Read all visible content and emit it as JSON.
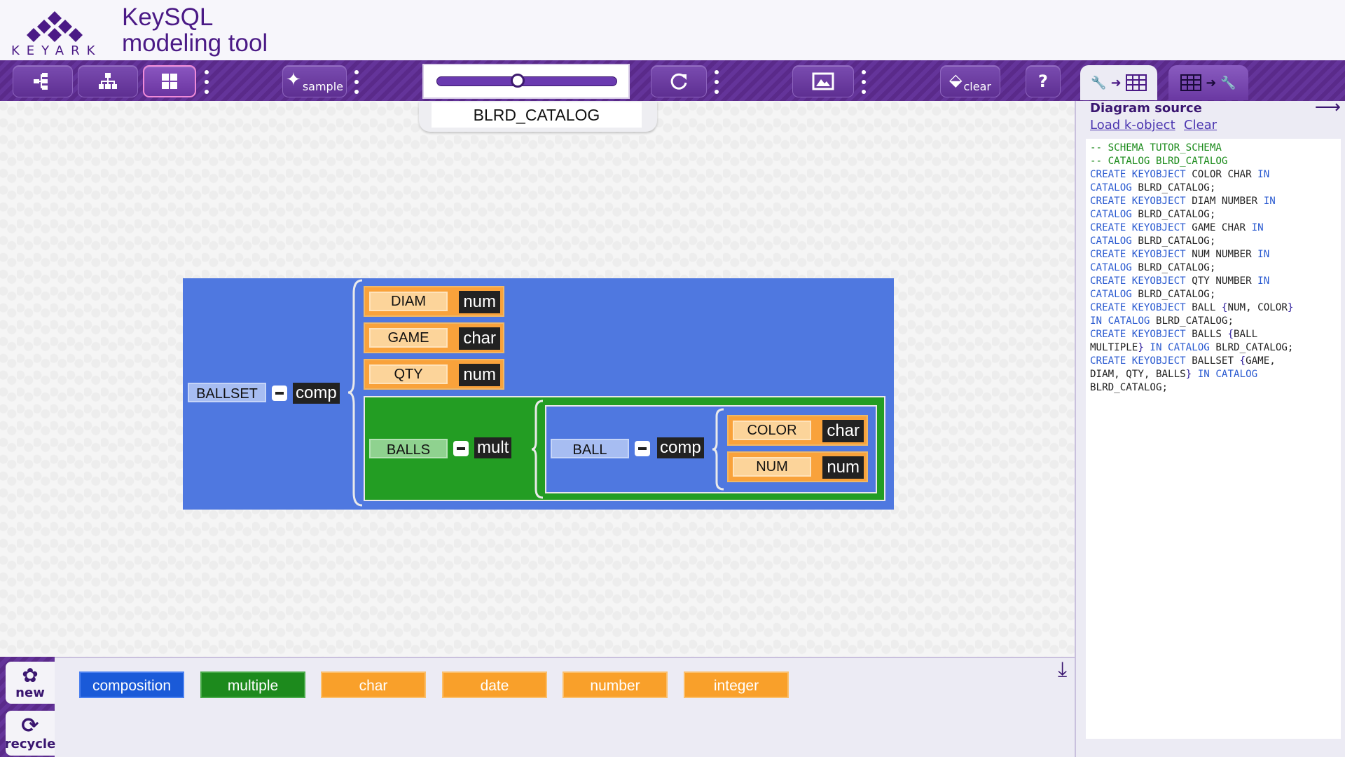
{
  "app": {
    "logo_text": "KEYARK",
    "title_line1": "KeySQL",
    "title_line2": "modeling tool"
  },
  "toolbar": {
    "sample_label": "sample",
    "clear_label": "clear",
    "help_label": "?",
    "zoom_level": 0.45
  },
  "canvas": {
    "catalog_name": "BLRD_CATALOG"
  },
  "diagram": {
    "ballset": {
      "name": "BALLSET",
      "kind": "comp"
    },
    "leaves": [
      {
        "name": "DIAM",
        "type": "num"
      },
      {
        "name": "GAME",
        "type": "char"
      },
      {
        "name": "QTY",
        "type": "num"
      }
    ],
    "balls": {
      "name": "BALLS",
      "kind": "mult"
    },
    "ball": {
      "name": "BALL",
      "kind": "comp"
    },
    "ball_leaves": [
      {
        "name": "COLOR",
        "type": "char"
      },
      {
        "name": "NUM",
        "type": "num"
      }
    ]
  },
  "palette": {
    "new_label": "new",
    "recycle_label": "recycle",
    "items": [
      "composition",
      "multiple",
      "char",
      "date",
      "number",
      "integer"
    ]
  },
  "right_panel": {
    "title": "Diagram source",
    "load_link": "Load k-object",
    "clear_link": "Clear",
    "code": [
      {
        "t": "c",
        "s": "-- SCHEMA TUTOR_SCHEMA"
      },
      {
        "t": "c",
        "s": "-- CATALOG BLRD_CATALOG"
      },
      {
        "t": "line",
        "parts": [
          [
            "k",
            "CREATE KEYOBJECT"
          ],
          [
            "n",
            " COLOR CHAR "
          ],
          [
            "k",
            "IN"
          ]
        ]
      },
      {
        "t": "line",
        "parts": [
          [
            "k",
            "CATALOG"
          ],
          [
            "n",
            " BLRD_CATALOG;"
          ]
        ]
      },
      {
        "t": "line",
        "parts": [
          [
            "k",
            "CREATE KEYOBJECT"
          ],
          [
            "n",
            " DIAM NUMBER "
          ],
          [
            "k",
            "IN"
          ]
        ]
      },
      {
        "t": "line",
        "parts": [
          [
            "k",
            "CATALOG"
          ],
          [
            "n",
            " BLRD_CATALOG;"
          ]
        ]
      },
      {
        "t": "line",
        "parts": [
          [
            "k",
            "CREATE KEYOBJECT"
          ],
          [
            "n",
            " GAME CHAR "
          ],
          [
            "k",
            "IN"
          ]
        ]
      },
      {
        "t": "line",
        "parts": [
          [
            "k",
            "CATALOG"
          ],
          [
            "n",
            " BLRD_CATALOG;"
          ]
        ]
      },
      {
        "t": "line",
        "parts": [
          [
            "k",
            "CREATE KEYOBJECT"
          ],
          [
            "n",
            " NUM NUMBER "
          ],
          [
            "k",
            "IN"
          ]
        ]
      },
      {
        "t": "line",
        "parts": [
          [
            "k",
            "CATALOG"
          ],
          [
            "n",
            " BLRD_CATALOG;"
          ]
        ]
      },
      {
        "t": "line",
        "parts": [
          [
            "k",
            "CREATE KEYOBJECT"
          ],
          [
            "n",
            " QTY NUMBER "
          ],
          [
            "k",
            "IN"
          ]
        ]
      },
      {
        "t": "line",
        "parts": [
          [
            "k",
            "CATALOG"
          ],
          [
            "n",
            " BLRD_CATALOG;"
          ]
        ]
      },
      {
        "t": "line",
        "parts": [
          [
            "k",
            "CREATE KEYOBJECT"
          ],
          [
            "n",
            " BALL "
          ],
          [
            "b",
            "{"
          ],
          [
            "n",
            "NUM, COLOR"
          ],
          [
            "b",
            "}"
          ]
        ]
      },
      {
        "t": "line",
        "parts": [
          [
            "k",
            "IN CATALOG"
          ],
          [
            "n",
            " BLRD_CATALOG;"
          ]
        ]
      },
      {
        "t": "line",
        "parts": [
          [
            "k",
            "CREATE KEYOBJECT"
          ],
          [
            "n",
            " BALLS "
          ],
          [
            "b",
            "{"
          ],
          [
            "n",
            "BALL"
          ]
        ]
      },
      {
        "t": "line",
        "parts": [
          [
            "n",
            "MULTIPLE"
          ],
          [
            "b",
            "}"
          ],
          [
            "k",
            " IN CATALOG"
          ],
          [
            "n",
            " BLRD_CATALOG;"
          ]
        ]
      },
      {
        "t": "line",
        "parts": [
          [
            "k",
            "CREATE KEYOBJECT"
          ],
          [
            "n",
            " BALLSET "
          ],
          [
            "b",
            "{"
          ],
          [
            "n",
            "GAME,"
          ]
        ]
      },
      {
        "t": "line",
        "parts": [
          [
            "n",
            "DIAM, QTY, BALLS"
          ],
          [
            "b",
            "}"
          ],
          [
            "k",
            " IN CATALOG"
          ]
        ]
      },
      {
        "t": "line",
        "parts": [
          [
            "n",
            "BLRD_CATALOG;"
          ]
        ]
      }
    ]
  }
}
